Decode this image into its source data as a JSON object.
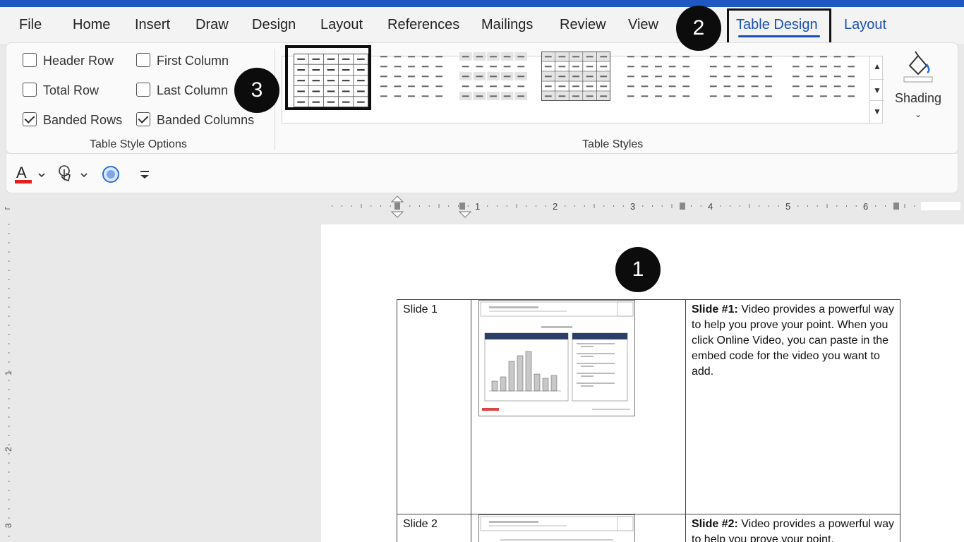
{
  "menu": {
    "file": "File",
    "home": "Home",
    "insert": "Insert",
    "draw": "Draw",
    "design": "Design",
    "layout": "Layout",
    "references": "References",
    "mailings": "Mailings",
    "review": "Review",
    "view": "View",
    "table_design": "Table Design",
    "layout2": "Layout",
    "active_color": "#1b4fb4"
  },
  "badges": {
    "b1": "1",
    "b2": "2",
    "b3": "3"
  },
  "table_style_options": {
    "label": "Table Style Options",
    "header_row": {
      "label": "Header Row",
      "checked": false
    },
    "total_row": {
      "label": "Total Row",
      "checked": false
    },
    "banded_rows": {
      "label": "Banded Rows",
      "checked": true
    },
    "first_column": {
      "label": "First Column",
      "checked": false
    },
    "last_column": {
      "label": "Last Column",
      "checked": false
    },
    "banded_columns": {
      "label": "Banded Columns",
      "checked": true
    }
  },
  "table_styles": {
    "label": "Table Styles",
    "selected_index": 0,
    "count": 7
  },
  "shading": {
    "label": "Shading",
    "icon": "paint-bucket-icon"
  },
  "qat": {
    "font_color_icon": "font-color-icon",
    "font_color": "#e02020",
    "touch_icon": "touch-mode-icon",
    "circle_icon": "record-icon",
    "customize_icon": "customize-qat-icon"
  },
  "ruler": {
    "marks": [
      "1",
      "2",
      "3",
      "4",
      "5",
      "6"
    ],
    "vmarks": [
      "1",
      "2",
      "3"
    ]
  },
  "document": {
    "rows": [
      {
        "slide": "Slide 1",
        "bold": "Slide #1:",
        "text": " Video provides a powerful way to help you prove your point. When you click Online Video, you can paste in the embed code for the video you want to add."
      },
      {
        "slide": "Slide 2",
        "bold": "Slide #2:",
        "text": " Video provides a powerful way to help you prove your point."
      }
    ]
  }
}
